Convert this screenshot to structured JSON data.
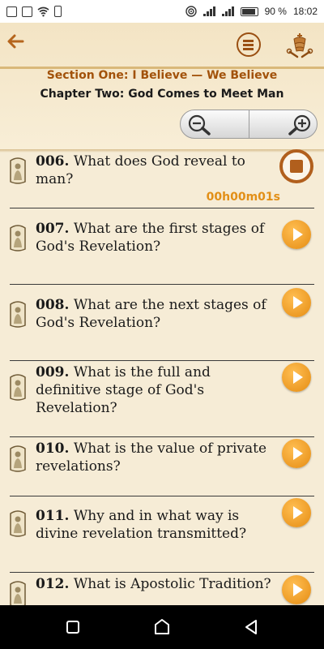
{
  "status_bar": {
    "battery_percent": "90 %",
    "time": "18:02"
  },
  "header": {
    "section_title": "Section One: I Believe — We Believe",
    "chapter_title": "Chapter Two: God Comes to Meet Man",
    "back_icon": "arrow-left-icon",
    "menu_icon": "menu-icon",
    "emblem_icon": "papal-emblem-icon",
    "zoom_out_icon": "zoom-out-icon",
    "zoom_in_icon": "zoom-in-icon"
  },
  "colors": {
    "accent": "#a2520a",
    "play_button": "#f2a02a",
    "timer": "#e28f17",
    "background": "#f6ecd6"
  },
  "questions": [
    {
      "number": "006.",
      "text": "What does God reveal to man?",
      "state": "playing",
      "timer": "00h00m01s"
    },
    {
      "number": "007.",
      "text": "What are the first stages of God's Revelation?",
      "state": "idle"
    },
    {
      "number": "008.",
      "text": "What are the next stages of God's Revelation?",
      "state": "idle"
    },
    {
      "number": "009.",
      "text": "What is the full and definitive stage of God's Revelation?",
      "state": "idle"
    },
    {
      "number": "010.",
      "text": "What is the value of private revelations?",
      "state": "idle"
    },
    {
      "number": "011.",
      "text": "Why and in what way is divine revelation transmitted?",
      "state": "idle"
    },
    {
      "number": "012.",
      "text": "What is Apostolic Tradition?",
      "state": "idle"
    }
  ],
  "nav": {
    "recent_icon": "recent-apps-icon",
    "home_icon": "home-icon",
    "back_icon": "back-triangle-icon"
  }
}
